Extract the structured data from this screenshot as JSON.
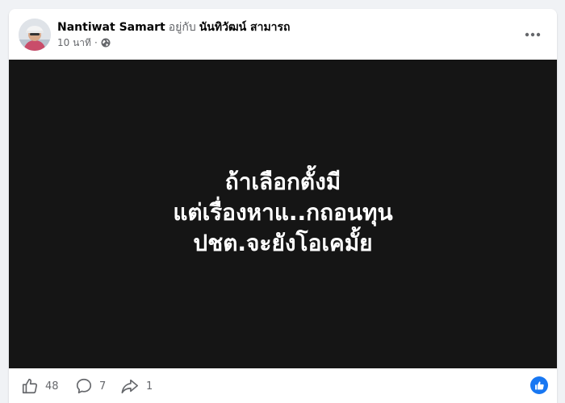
{
  "post": {
    "author": "Nantiwat Samart",
    "with_text": "อยู่กับ",
    "tagged": "นันทิวัฒน์ สามารถ",
    "time": "10 นาที",
    "separator": "·",
    "privacy_icon": "globe-icon",
    "more_icon": "more-options-icon"
  },
  "media": {
    "lines": [
      "ถ้าเลือกตั้งมี",
      "แต่เรื่องหาแ..กถอนทุน",
      "ปชต.จะยังโอเคมั้ย"
    ],
    "background": "#151515",
    "text_color": "#ffffff"
  },
  "footer": {
    "reactions": {
      "icon": "thumbs-up-icon",
      "count": "48"
    },
    "comments": {
      "icon": "comment-icon",
      "count": "7"
    },
    "shares": {
      "icon": "share-icon",
      "count": "1"
    },
    "like_badge_icon": "like-badge-icon",
    "accent": "#1877f2"
  }
}
